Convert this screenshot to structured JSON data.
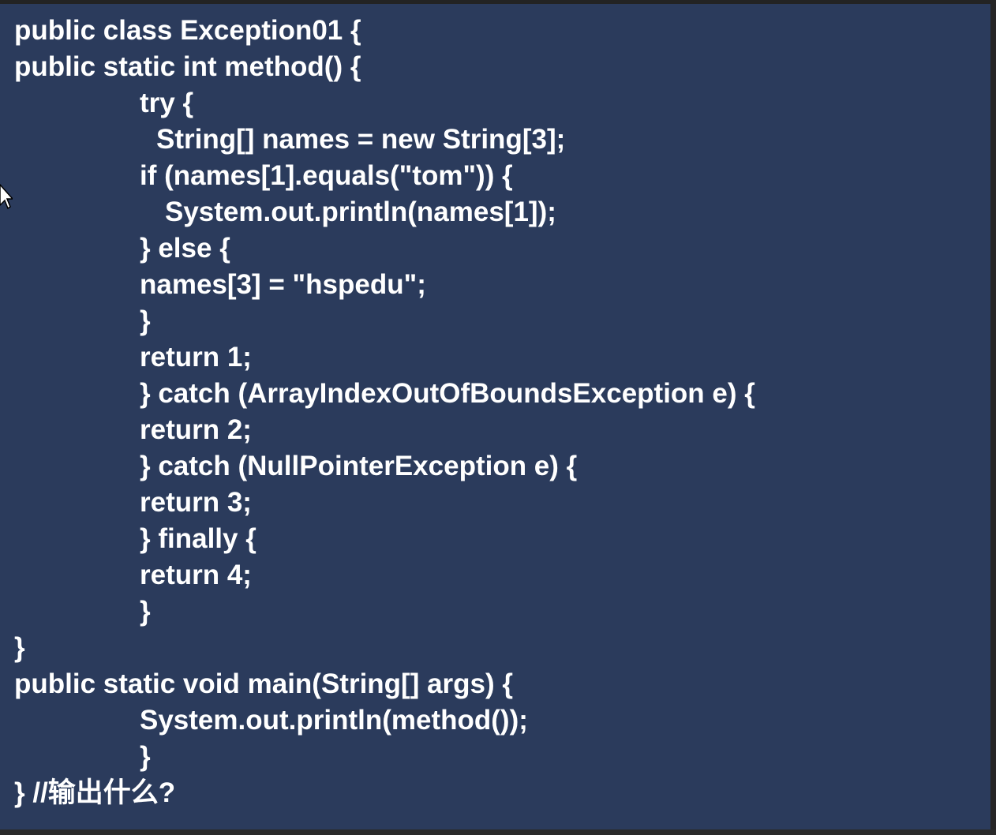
{
  "slide": {
    "background_color": "#2b3b5c",
    "text_color": "#ffffff",
    "code_lines": [
      "public class Exception01 {",
      "public static int method() {",
      "try {",
      "String[] names = new String[3];",
      "if (names[1].equals(\"tom\")) {",
      "System.out.println(names[1]);",
      "} else {",
      "names[3] = \"hspedu\";",
      "}",
      "return 1;",
      "} catch (ArrayIndexOutOfBoundsException e) {",
      "return 2;",
      "} catch (NullPointerException e) {",
      "return 3;",
      "} finally {",
      "return 4;",
      "}",
      "}",
      "public static void main(String[] args) {",
      "System.out.println(method());",
      "}",
      "} //输出什么?"
    ]
  },
  "cursor": {
    "icon": "mouse-pointer-icon"
  }
}
